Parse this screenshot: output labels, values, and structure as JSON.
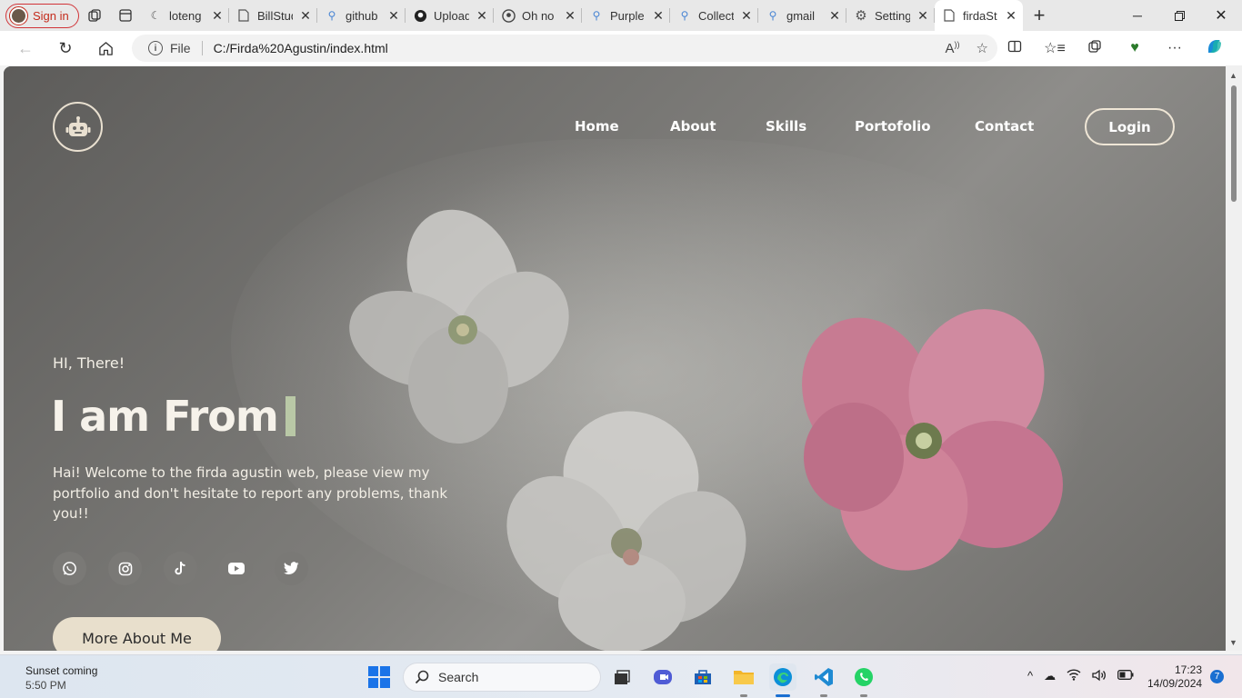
{
  "browser": {
    "profile_label": "Sign in",
    "tabs": [
      {
        "title": "loteng",
        "icon": "moon-icon"
      },
      {
        "title": "BillStud",
        "icon": "page-icon"
      },
      {
        "title": "github",
        "icon": "search-icon"
      },
      {
        "title": "Upload",
        "icon": "github-icon"
      },
      {
        "title": "Oh no",
        "icon": "github-icon"
      },
      {
        "title": "Purple",
        "icon": "search-icon"
      },
      {
        "title": "Collect",
        "icon": "search-icon"
      },
      {
        "title": "gmail",
        "icon": "search-icon"
      },
      {
        "title": "Setting",
        "icon": "gear-icon"
      },
      {
        "title": "firdaSt",
        "icon": "page-icon"
      }
    ],
    "address": {
      "scheme_label": "File",
      "url": "C:/Firda%20Agustin/index.html"
    }
  },
  "site": {
    "nav": {
      "home": "Home",
      "about": "About",
      "skills": "Skills",
      "portfolio": "Portofolio",
      "contact": "Contact"
    },
    "login_label": "Login",
    "hero": {
      "greeting": "HI, There!",
      "headline": "I am From",
      "description": "Hai! Welcome to the firda agustin web, please view my portfolio and don't hesitate to report any problems, thank you!!",
      "cta_label": "More About Me"
    },
    "social": [
      "whatsapp-icon",
      "instagram-icon",
      "tiktok-icon",
      "youtube-icon",
      "twitter-icon"
    ],
    "colors": {
      "accent": "#e8dfcc",
      "cursor": "#b9c8a6"
    }
  },
  "taskbar": {
    "weather_title": "Sunset coming",
    "weather_time": "5:50 PM",
    "search_placeholder": "Search",
    "time": "17:23",
    "date": "14/09/2024",
    "notifications": "7"
  }
}
